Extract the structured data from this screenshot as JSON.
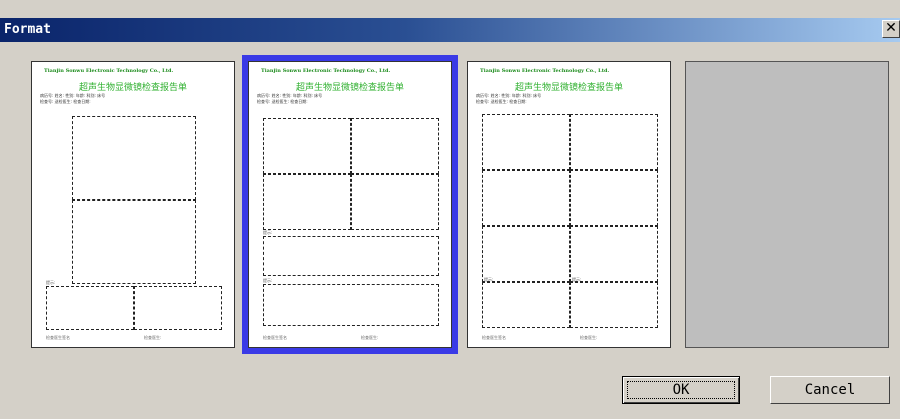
{
  "window": {
    "title": "Format",
    "close_glyph": "✕"
  },
  "templates": [
    {
      "name": "layout-1",
      "selected": false,
      "company": "Tianjin Sonwu Electronic Technology Co., Ltd.",
      "report_title": "超声生物显微镜检查报告单",
      "meta_line_1": "病历号:        姓名:          性别:     年龄:    科别:  床号",
      "meta_line_2": "检查号:        送检医生:          检查日期:",
      "comment_label": "提示:",
      "footer_left": "检查医生签名",
      "footer_right": "检查医生:"
    },
    {
      "name": "layout-2",
      "selected": true,
      "company": "Tianjin Sonwu Electronic Technology Co., Ltd.",
      "report_title": "超声生物显微镜检查报告单",
      "meta_line_1": "病历号:        姓名:          性别:     年龄:    科别:  床号",
      "meta_line_2": "检查号:        送检医生:          检查日期:",
      "comment_label": "提示:",
      "footer_left": "检查医生签名",
      "footer_right": "检查医生:"
    },
    {
      "name": "layout-3",
      "selected": false,
      "company": "Tianjin Sonwu Electronic Technology Co., Ltd.",
      "report_title": "超声生物显微镜检查报告单",
      "meta_line_1": "病历号:        姓名:          性别:     年龄:    科别:  床号",
      "meta_line_2": "检查号:        送检医生:          检查日期:",
      "comment_label": "提示:",
      "footer_left": "检查医生签名",
      "footer_right": "检查医生:"
    }
  ],
  "buttons": {
    "ok": "OK",
    "cancel": "Cancel"
  },
  "colors": {
    "selected_outline": "#3a3ae6",
    "title_gradient_start": "#0a246a",
    "report_title": "#2fb02f"
  }
}
